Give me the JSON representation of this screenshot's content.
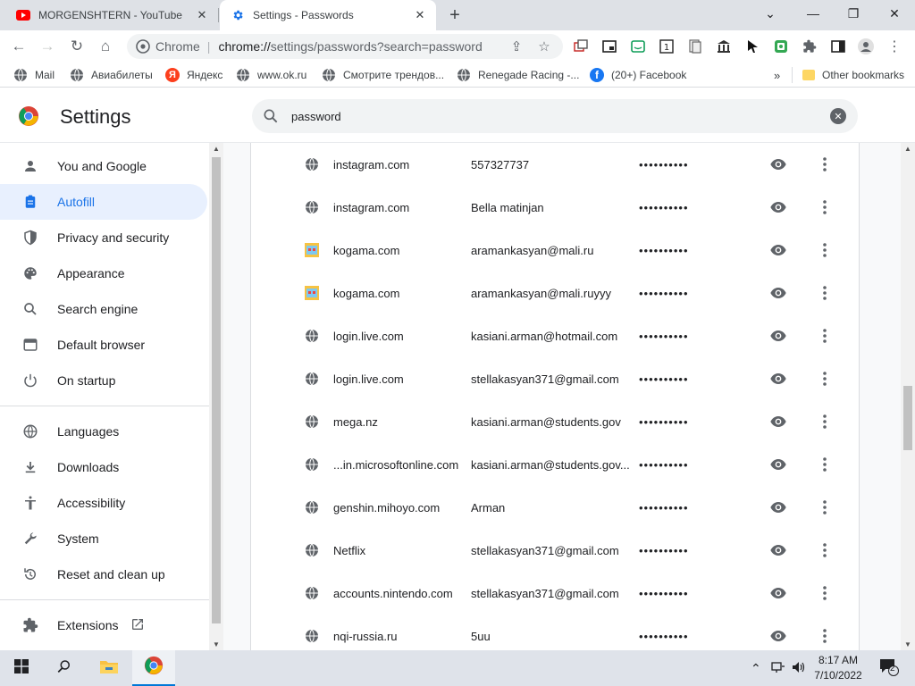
{
  "tabs": [
    {
      "title": "MORGENSHTERN - YouTube",
      "icon": "youtube-icon"
    },
    {
      "title": "Settings - Passwords",
      "icon": "gear-icon"
    }
  ],
  "omnibox": {
    "scheme": "Chrome",
    "host": "chrome://",
    "path": "settings/passwords?search=password"
  },
  "bookmarks": [
    {
      "label": "Mail"
    },
    {
      "label": "Авиабилеты"
    },
    {
      "label": "Яндекс"
    },
    {
      "label": "www.ok.ru"
    },
    {
      "label": "Смотрите трендов..."
    },
    {
      "label": "Renegade Racing -..."
    },
    {
      "label": "(20+) Facebook"
    }
  ],
  "bookmarks_more": "»",
  "other_bookmarks": "Other bookmarks",
  "settings": {
    "title": "Settings",
    "search_value": "password"
  },
  "sidebar": {
    "items": [
      {
        "label": "You and Google",
        "icon": "person-icon"
      },
      {
        "label": "Autofill",
        "icon": "clipboard-icon",
        "active": true
      },
      {
        "label": "Privacy and security",
        "icon": "shield-icon"
      },
      {
        "label": "Appearance",
        "icon": "palette-icon"
      },
      {
        "label": "Search engine",
        "icon": "search-icon"
      },
      {
        "label": "Default browser",
        "icon": "browser-icon"
      },
      {
        "label": "On startup",
        "icon": "power-icon"
      },
      {
        "label": "Languages",
        "icon": "globe-icon"
      },
      {
        "label": "Downloads",
        "icon": "download-icon"
      },
      {
        "label": "Accessibility",
        "icon": "accessibility-icon"
      },
      {
        "label": "System",
        "icon": "wrench-icon"
      },
      {
        "label": "Reset and clean up",
        "icon": "reset-icon"
      },
      {
        "label": "Extensions",
        "icon": "puzzle-icon"
      }
    ]
  },
  "passwords": [
    {
      "site": "instagram.com",
      "user": "557327737",
      "password": "••••••••••",
      "icon": "globe-icon"
    },
    {
      "site": "instagram.com",
      "user": "Bella matinjan",
      "password": "••••••••••",
      "icon": "globe-icon"
    },
    {
      "site": "kogama.com",
      "user": "aramankasyan@mali.ru",
      "password": "••••••••••",
      "icon": "kogama-icon"
    },
    {
      "site": "kogama.com",
      "user": "aramankasyan@mali.ruyyy",
      "password": "••••••••••",
      "icon": "kogama-icon"
    },
    {
      "site": "login.live.com",
      "user": "kasiani.arman@hotmail.com",
      "password": "••••••••••",
      "icon": "globe-icon"
    },
    {
      "site": "login.live.com",
      "user": "stellakasyan371@gmail.com",
      "password": "••••••••••",
      "icon": "globe-icon"
    },
    {
      "site": "mega.nz",
      "user": "kasiani.arman@students.gov",
      "password": "••••••••••",
      "icon": "globe-icon"
    },
    {
      "site": "...in.microsoftonline.com",
      "user": "kasiani.arman@students.gov...",
      "password": "••••••••••",
      "icon": "globe-icon"
    },
    {
      "site": "genshin.mihoyo.com",
      "user": "Arman",
      "password": "••••••••••",
      "icon": "globe-icon"
    },
    {
      "site": "Netflix",
      "user": "stellakasyan371@gmail.com",
      "password": "••••••••••",
      "icon": "globe-icon"
    },
    {
      "site": "accounts.nintendo.com",
      "user": "stellakasyan371@gmail.com",
      "password": "••••••••••",
      "icon": "globe-icon"
    },
    {
      "site": "nqi-russia.ru",
      "user": "5uu",
      "password": "••••••••••",
      "icon": "globe-icon"
    }
  ],
  "taskbar": {
    "time": "8:17 AM",
    "date": "7/10/2022",
    "notifications": "2"
  },
  "colors": {
    "accent": "#1a73e8",
    "active_nav_bg": "#e8f0fe",
    "tabstrip": "#dee1e6",
    "taskbar": "#dfe3ea"
  }
}
